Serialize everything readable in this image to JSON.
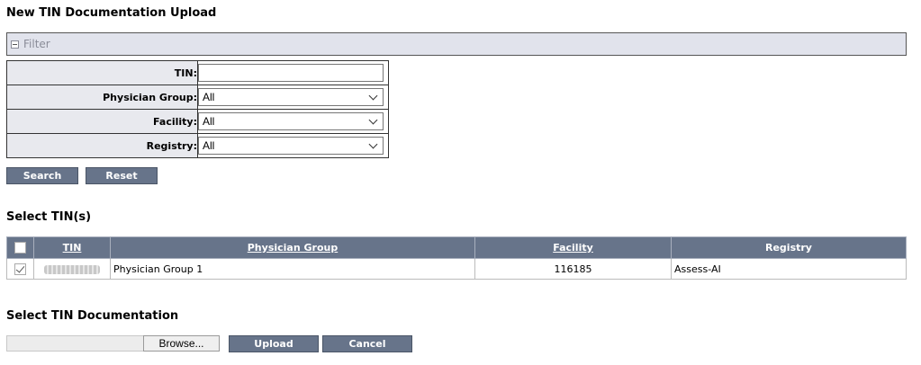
{
  "page": {
    "title": "New TIN Documentation Upload"
  },
  "filter": {
    "label": "Filter",
    "fields": {
      "tin_label": "TIN:",
      "tin_value": "",
      "physician_group_label": "Physician Group:",
      "physician_group_value": "All",
      "facility_label": "Facility:",
      "facility_value": "All",
      "registry_label": "Registry:",
      "registry_value": "All"
    },
    "search_label": "Search",
    "reset_label": "Reset"
  },
  "select_tins": {
    "title": "Select TIN(s)",
    "columns": {
      "tin": "TIN",
      "physician_group": "Physician Group",
      "facility": "Facility",
      "registry": "Registry"
    },
    "rows": [
      {
        "checked": true,
        "tin": "",
        "physician_group": "Physician Group 1",
        "facility": "116185",
        "registry": "Assess-AI"
      }
    ]
  },
  "documentation": {
    "title": "Select TIN Documentation",
    "browse_label": "Browse...",
    "upload_label": "Upload",
    "cancel_label": "Cancel"
  },
  "colors": {
    "header_bg": "#67748a",
    "filter_bg": "#e1e3ec"
  },
  "icons": {
    "filter_toggle": "collapse-icon",
    "select_chevron": "chevron-down-icon",
    "checkbox": "checkbox-icon"
  }
}
